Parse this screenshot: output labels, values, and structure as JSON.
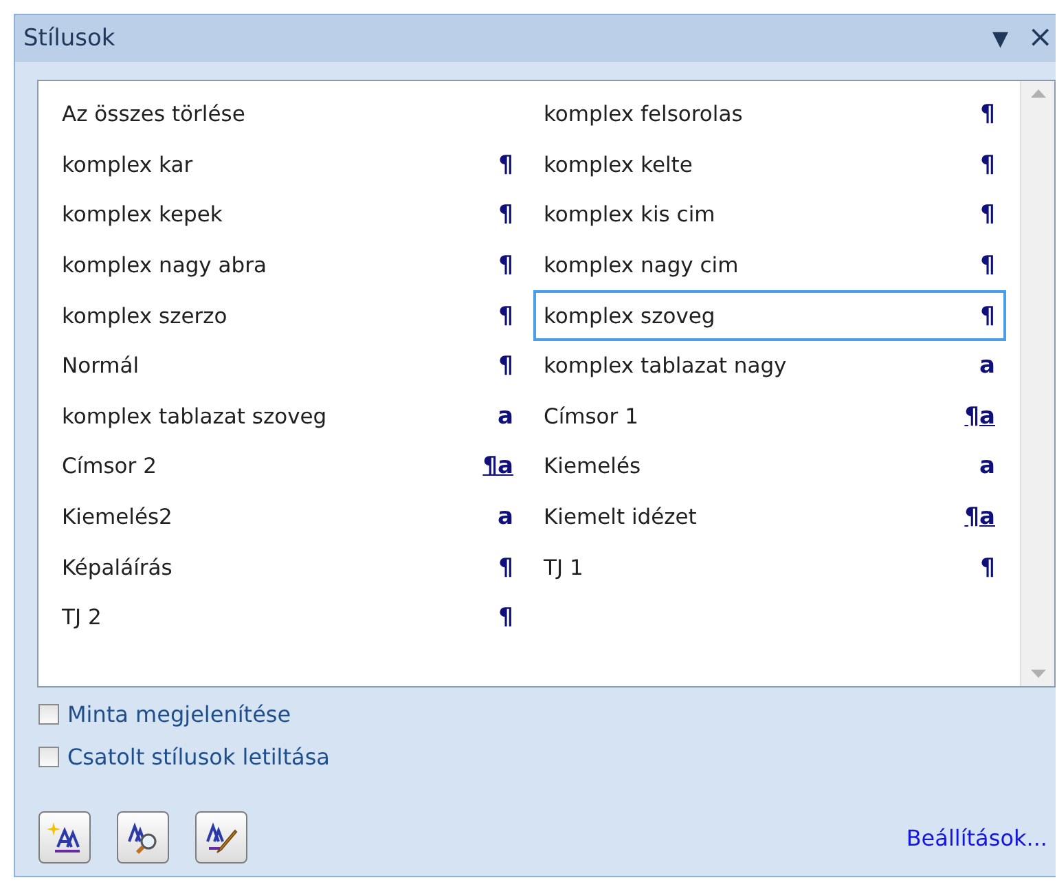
{
  "pane": {
    "title": "Stílusok",
    "menu_glyph": "▼",
    "close_glyph": "×"
  },
  "styles": [
    {
      "name": "Az összes törlése",
      "kind": "none",
      "selected": false
    },
    {
      "name": "komplex felsorolas",
      "kind": "paragraph",
      "symbol": "¶",
      "selected": false
    },
    {
      "name": "komplex kar",
      "kind": "paragraph",
      "symbol": "¶",
      "selected": false
    },
    {
      "name": "komplex kelte",
      "kind": "paragraph",
      "symbol": "¶",
      "selected": false
    },
    {
      "name": "komplex kepek",
      "kind": "paragraph",
      "symbol": "¶",
      "selected": false
    },
    {
      "name": "komplex kis cim",
      "kind": "paragraph",
      "symbol": "¶",
      "selected": false
    },
    {
      "name": "komplex nagy abra",
      "kind": "paragraph",
      "symbol": "¶",
      "selected": false
    },
    {
      "name": "komplex nagy cim",
      "kind": "paragraph",
      "symbol": "¶",
      "selected": false
    },
    {
      "name": "komplex szerzo",
      "kind": "paragraph",
      "symbol": "¶",
      "selected": false
    },
    {
      "name": "komplex szoveg",
      "kind": "paragraph",
      "symbol": "¶",
      "selected": true
    },
    {
      "name": "Normál",
      "kind": "paragraph",
      "symbol": "¶",
      "selected": false
    },
    {
      "name": "komplex tablazat nagy",
      "kind": "character",
      "symbol": "a",
      "selected": false
    },
    {
      "name": "komplex tablazat szoveg",
      "kind": "character",
      "symbol": "a",
      "selected": false
    },
    {
      "name": "Címsor 1",
      "kind": "linked",
      "symbol": "¶a",
      "selected": false
    },
    {
      "name": "Címsor 2",
      "kind": "linked",
      "symbol": "¶a",
      "selected": false
    },
    {
      "name": "Kiemelés",
      "kind": "character",
      "symbol": "a",
      "selected": false
    },
    {
      "name": "Kiemelés2",
      "kind": "character",
      "symbol": "a",
      "selected": false
    },
    {
      "name": "Kiemelt idézet",
      "kind": "linked",
      "symbol": "¶a",
      "selected": false
    },
    {
      "name": "Képaláírás",
      "kind": "paragraph",
      "symbol": "¶",
      "selected": false
    },
    {
      "name": "TJ 1",
      "kind": "paragraph",
      "symbol": "¶",
      "selected": false
    },
    {
      "name": "TJ 2",
      "kind": "paragraph",
      "symbol": "¶",
      "selected": false
    }
  ],
  "options": [
    {
      "label": "Minta megjelenítése",
      "checked": false
    },
    {
      "label": "Csatolt stílusok letiltása",
      "checked": false
    }
  ],
  "tools": [
    {
      "kind": "new"
    },
    {
      "kind": "inspect"
    },
    {
      "kind": "manage"
    }
  ],
  "settings_link": "Beállítások..."
}
